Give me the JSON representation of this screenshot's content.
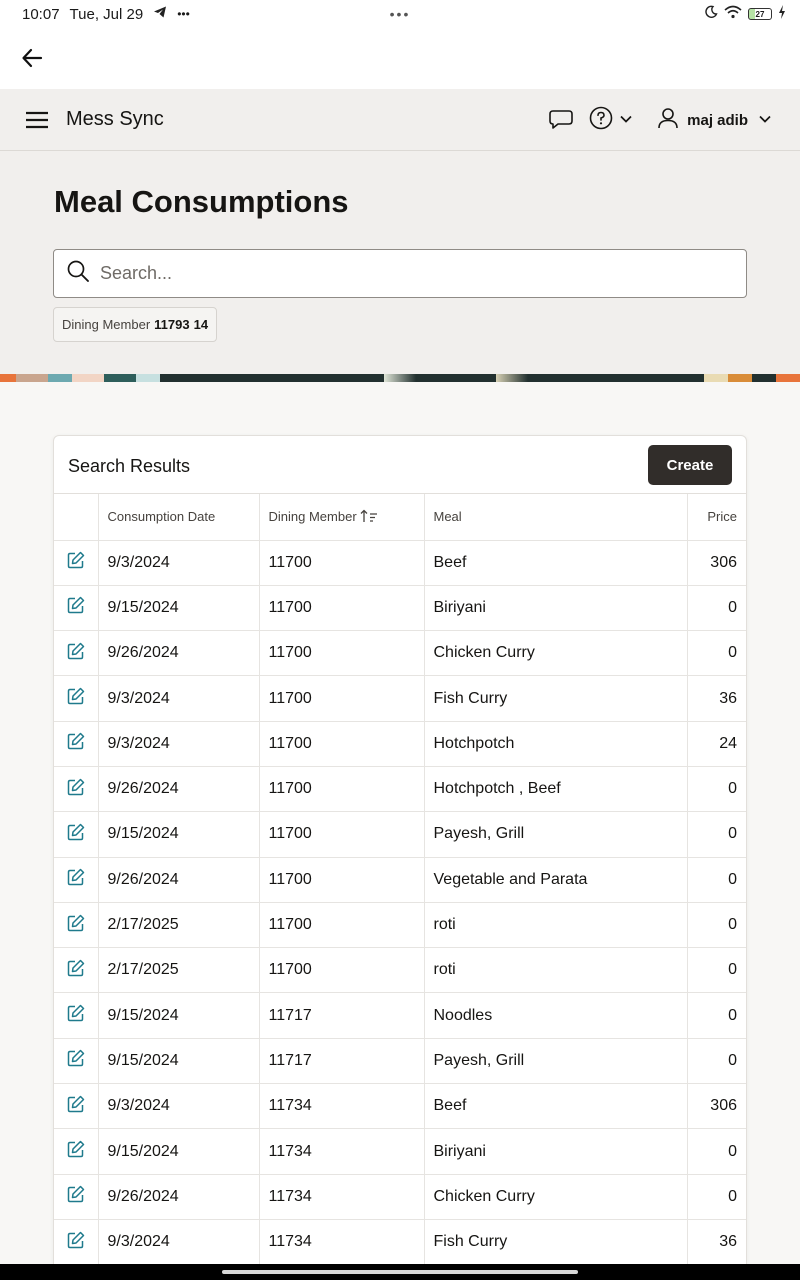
{
  "status_bar": {
    "time": "10:07",
    "date": "Tue, Jul 29",
    "more": "•••",
    "center_dots": "•••",
    "battery": "27"
  },
  "header": {
    "app_title": "Mess Sync",
    "user_name": "maj adib"
  },
  "page": {
    "title": "Meal Consumptions"
  },
  "search": {
    "placeholder": "Search..."
  },
  "filter_chip": {
    "label": "Dining Member",
    "value": "11793",
    "count": "14"
  },
  "results": {
    "title": "Search Results",
    "create_label": "Create",
    "columns": {
      "date": "Consumption Date",
      "member": "Dining Member",
      "meal": "Meal",
      "price": "Price"
    },
    "rows": [
      {
        "date": "9/3/2024",
        "member": "11700",
        "meal": "Beef",
        "price": "306"
      },
      {
        "date": "9/15/2024",
        "member": "11700",
        "meal": "Biriyani",
        "price": "0"
      },
      {
        "date": "9/26/2024",
        "member": "11700",
        "meal": "Chicken Curry",
        "price": "0"
      },
      {
        "date": "9/3/2024",
        "member": "11700",
        "meal": "Fish Curry",
        "price": "36"
      },
      {
        "date": "9/3/2024",
        "member": "11700",
        "meal": "Hotchpotch",
        "price": "24"
      },
      {
        "date": "9/26/2024",
        "member": "11700",
        "meal": "Hotchpotch , Beef",
        "price": "0"
      },
      {
        "date": "9/15/2024",
        "member": "11700",
        "meal": "Payesh, Grill",
        "price": "0"
      },
      {
        "date": "9/26/2024",
        "member": "11700",
        "meal": "Vegetable and Parata",
        "price": "0"
      },
      {
        "date": "2/17/2025",
        "member": "11700",
        "meal": "roti",
        "price": "0"
      },
      {
        "date": "2/17/2025",
        "member": "11700",
        "meal": "roti",
        "price": "0"
      },
      {
        "date": "9/15/2024",
        "member": "11717",
        "meal": "Noodles",
        "price": "0"
      },
      {
        "date": "9/15/2024",
        "member": "11717",
        "meal": "Payesh, Grill",
        "price": "0"
      },
      {
        "date": "9/3/2024",
        "member": "11734",
        "meal": "Beef",
        "price": "306"
      },
      {
        "date": "9/15/2024",
        "member": "11734",
        "meal": "Biriyani",
        "price": "0"
      },
      {
        "date": "9/26/2024",
        "member": "11734",
        "meal": "Chicken Curry",
        "price": "0"
      },
      {
        "date": "9/3/2024",
        "member": "11734",
        "meal": "Fish Curry",
        "price": "36"
      }
    ]
  },
  "icons": {
    "back": "arrow-left-icon",
    "menu": "hamburger-menu-icon",
    "chat": "chat-bubble-icon",
    "help": "help-circle-icon",
    "user": "user-icon",
    "search": "search-icon",
    "edit": "edit-pencil-icon",
    "sort": "sort-ascending-icon"
  },
  "colors": {
    "accent": "#1f7a8c",
    "header_bg": "#f1efed",
    "button_dark": "#312d2a"
  }
}
